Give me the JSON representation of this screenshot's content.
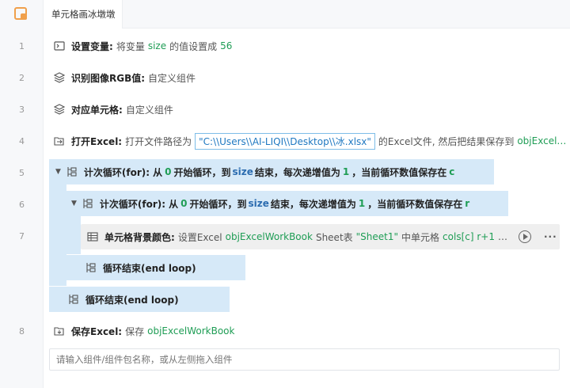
{
  "tab": {
    "title": "单元格画冰墩墩"
  },
  "line_numbers": [
    "1",
    "2",
    "3",
    "4",
    "5",
    "6",
    "7",
    "8"
  ],
  "steps": {
    "set_var": {
      "title": "设置变量:",
      "pre": "将变量",
      "var": "size",
      "mid": "的值设置成",
      "value": "56"
    },
    "rgb": {
      "title": "识别图像RGB值:",
      "desc": "自定义组件"
    },
    "cell": {
      "title": "对应单元格:",
      "desc": "自定义组件"
    },
    "open_excel": {
      "title": "打开Excel:",
      "pre": "打开文件路径为",
      "path": "\"C:\\\\Users\\\\AI-LIQI\\\\Desktop\\\\冰.xlsx\"",
      "mid": "的Excel文件, 然后把结果保存到",
      "var": "objExcel…"
    },
    "loop_outer": {
      "title": "计次循环(for):",
      "p1": "从",
      "start": "0",
      "p2": "开始循环，到",
      "end": "size",
      "p3": "结束，每次递增值为",
      "step": "1",
      "p4": "，当前循环数值保存在",
      "var": "c"
    },
    "loop_inner": {
      "title": "计次循环(for):",
      "p1": "从",
      "start": "0",
      "p2": "开始循环，到",
      "end": "size",
      "p3": "结束，每次递增值为",
      "step": "1",
      "p4": "，当前循环数值保存在",
      "var": "r"
    },
    "cell_bg": {
      "title": "单元格背景颜色:",
      "pre": "设置Excel",
      "wb": "objExcelWorkBook",
      "sheet_label": "Sheet表",
      "sheet": "\"Sheet1\"",
      "mid": "中单元格",
      "cell": "cols[c] r+1",
      "ellipsis": "…",
      "more": "···"
    },
    "end_inner": {
      "title": "循环结束(end loop)"
    },
    "end_outer": {
      "title": "循环结束(end loop)"
    },
    "save_excel": {
      "title": "保存Excel:",
      "pre": "保存",
      "wb": "objExcelWorkBook"
    }
  },
  "input": {
    "placeholder": "请输入组件/组件包名称，或从左侧拖入组件"
  },
  "colors": {
    "accent": "#1f9d55",
    "block": "#d6e9f8",
    "path": "#1f78c1",
    "logo": "#f0a04b"
  }
}
